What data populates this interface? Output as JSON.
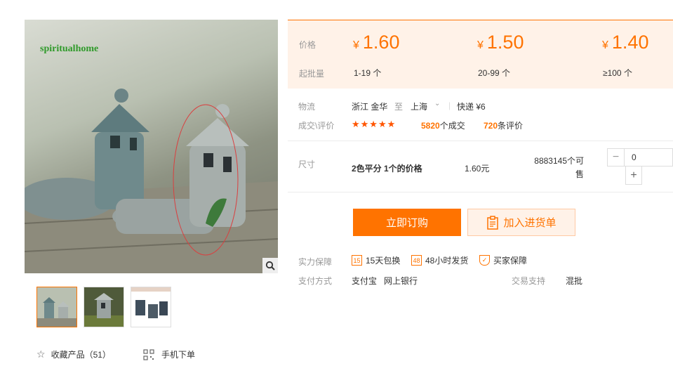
{
  "gallery": {
    "watermark": "spiritualhome",
    "thumbnail_count": 3
  },
  "actions": {
    "favorite_label": "收藏产品（51）",
    "mobile_label": "手机下单"
  },
  "pricing": {
    "price_label": "价格",
    "moq_label": "起批量",
    "tiers": [
      {
        "currency": "¥",
        "price": "1.60",
        "qty": "1-19 个"
      },
      {
        "currency": "¥",
        "price": "1.50",
        "qty": "20-99 个"
      },
      {
        "currency": "¥",
        "price": "1.40",
        "qty": "≥100 个"
      }
    ]
  },
  "logistics": {
    "label": "物流",
    "from": "浙江 金华",
    "to_word": "至",
    "to": "上海",
    "shipping": "快递 ¥6"
  },
  "deals": {
    "label": "成交\\评价",
    "stars": "★★★★★",
    "orders_count": "5820",
    "orders_suffix": "个成交",
    "reviews_count": "720",
    "reviews_suffix": "条评价"
  },
  "sku": {
    "label": "尺寸",
    "name": "2色平分 1个的价格",
    "price": "1.60元",
    "stock": "8883145个可售",
    "quantity": "0",
    "minus": "−",
    "plus": "+"
  },
  "buttons": {
    "order": "立即订购",
    "cart": "加入进货单"
  },
  "guarantee": {
    "label": "实力保障",
    "items": [
      {
        "icon": "calendar-icon",
        "glyph": "15",
        "text": "15天包换"
      },
      {
        "icon": "clock-48-icon",
        "glyph": "48",
        "text": "48小时发货"
      },
      {
        "icon": "shield-icon",
        "glyph": "✓",
        "text": "买家保障"
      }
    ]
  },
  "payment": {
    "label": "支付方式",
    "methods": "支付宝   网上银行",
    "trade_label": "交易支持",
    "trade_value": "混批"
  },
  "colors": {
    "accent": "#ff7300",
    "price_bg": "#fff2e8"
  }
}
